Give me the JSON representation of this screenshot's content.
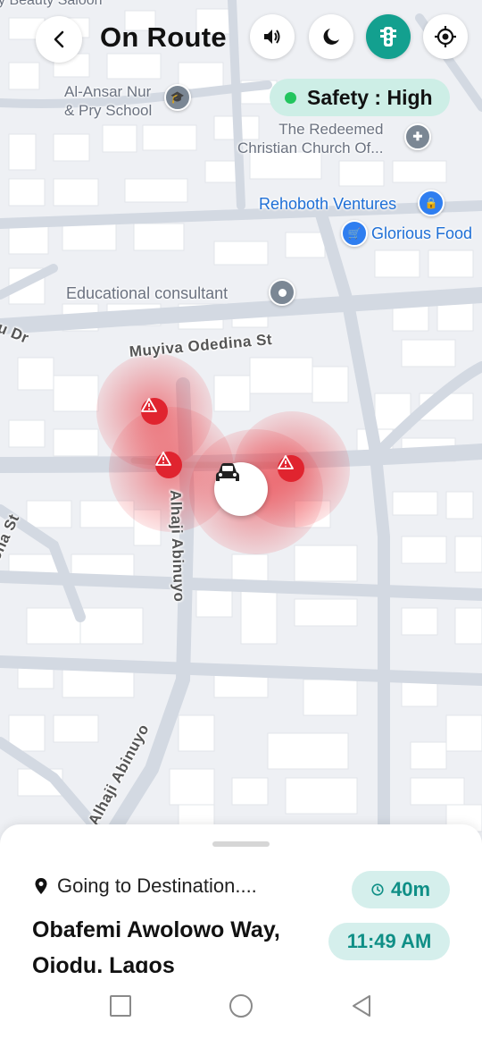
{
  "header": {
    "title": "On Route",
    "top_cut_label": "y Beauty Saloon",
    "icons": [
      "back-icon",
      "sound-icon",
      "night-mode-icon",
      "traffic-light-icon",
      "locate-icon"
    ]
  },
  "safety": {
    "label": "Safety : High",
    "dot_color": "#22c55e"
  },
  "map": {
    "pois": {
      "school": "Al-Ansar Nur\n& Pry School",
      "church": "The Redeemed\nChristian Church Of...",
      "rehoboth": "Rehoboth Ventures",
      "glorious": "Glorious Food",
      "consultant": "Educational consultant",
      "partial_top": "e"
    },
    "streets": {
      "muyiva": "Muyiva Odedina St",
      "abinuyo_upper": "Alhaji Abinuyo",
      "abinuyo_lower": "Alhaji Abinuyo",
      "dr": "u Dr",
      "ona": "ona St"
    },
    "hazard_color": "#e0242f",
    "vehicle_icon": "car-icon"
  },
  "sheet": {
    "going_label": "Going to Destination....",
    "destination_line1": "Obafemi Awolowo Way,",
    "destination_line2": "Ojodu, Lagos",
    "duration": "40m",
    "eta": "11:49 AM",
    "accent": "#0f8f86"
  },
  "navbar": {
    "icons": [
      "recent-apps-icon",
      "home-icon",
      "back-nav-icon"
    ]
  }
}
